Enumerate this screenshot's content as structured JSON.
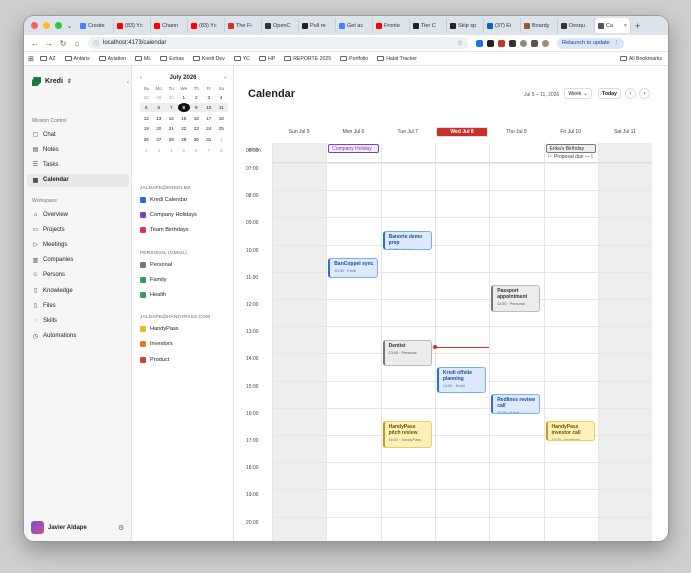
{
  "browser": {
    "tabs": [
      {
        "label": "Create",
        "color": "#4285f4"
      },
      {
        "label": "(83) Yc",
        "color": "#ff0000"
      },
      {
        "label": "Chann",
        "color": "#ff0000"
      },
      {
        "label": "(83) Yc",
        "color": "#ff0000"
      },
      {
        "label": "The Fi",
        "color": "#d93025"
      },
      {
        "label": "OpenC",
        "color": "#333333"
      },
      {
        "label": "Pull re",
        "color": "#222222"
      },
      {
        "label": "Get ac",
        "color": "#4285f4"
      },
      {
        "label": "Fronte",
        "color": "#ff0000"
      },
      {
        "label": "Tier C",
        "color": "#222222"
      },
      {
        "label": "Skip sp",
        "color": "#222222"
      },
      {
        "label": "(37) Ei",
        "color": "#0a66c2"
      },
      {
        "label": "Boardy",
        "color": "#8a5a3c"
      },
      {
        "label": "Desqu",
        "color": "#333333"
      },
      {
        "label": "Ca",
        "color": "#555555",
        "active": true
      }
    ],
    "url": "localhost:4173/calendar",
    "relaunch": "Relaunch to update",
    "bookmarks": [
      "AZ",
      "Antaris",
      "Aviation",
      "ML",
      "Extras",
      "Kredi Dev",
      "YC",
      "HP",
      "REPORTE 2025",
      "Portfolio",
      "Habit Tracker"
    ],
    "all_bookmarks": "All Bookmarks"
  },
  "sidebar": {
    "brand": "Kredi",
    "section1": "Mission Control",
    "items1": [
      {
        "label": "Chat",
        "icon": "chat-icon",
        "glyph": "▢"
      },
      {
        "label": "Notes",
        "icon": "notes-icon",
        "glyph": "▤"
      },
      {
        "label": "Tasks",
        "icon": "tasks-icon",
        "glyph": "☰"
      },
      {
        "label": "Calendar",
        "icon": "calendar-icon",
        "glyph": "▦",
        "selected": true
      }
    ],
    "section2": "Workspace",
    "items2": [
      {
        "label": "Overview",
        "icon": "home-icon",
        "glyph": "⌂"
      },
      {
        "label": "Projects",
        "icon": "folder-icon",
        "glyph": "▭"
      },
      {
        "label": "Meetings",
        "icon": "video-icon",
        "glyph": "▷"
      },
      {
        "label": "Companies",
        "icon": "building-icon",
        "glyph": "▥"
      },
      {
        "label": "Persons",
        "icon": "people-icon",
        "glyph": "☺"
      },
      {
        "label": "Knowledge",
        "icon": "book-icon",
        "glyph": "▯"
      },
      {
        "label": "Files",
        "icon": "file-icon",
        "glyph": "▯"
      },
      {
        "label": "Skills",
        "icon": "bulb-icon",
        "glyph": "◌"
      },
      {
        "label": "Automations",
        "icon": "clock-icon",
        "glyph": "◷"
      }
    ],
    "user": "Javier Aldape"
  },
  "mini_calendar": {
    "month": "July 2026",
    "weekdays": [
      "Su",
      "Mo",
      "Tu",
      "We",
      "Th",
      "Fr",
      "Sa"
    ],
    "weeks": [
      [
        "28",
        "29",
        "30",
        "1",
        "2",
        "3",
        "4"
      ],
      [
        "5",
        "6",
        "7",
        "8",
        "9",
        "10",
        "11"
      ],
      [
        "12",
        "13",
        "14",
        "15",
        "16",
        "17",
        "18"
      ],
      [
        "19",
        "20",
        "21",
        "22",
        "23",
        "24",
        "25"
      ],
      [
        "26",
        "27",
        "28",
        "29",
        "30",
        "31",
        "1"
      ],
      [
        "2",
        "3",
        "4",
        "5",
        "6",
        "7",
        "8"
      ]
    ],
    "today": "8"
  },
  "calendar_lists": [
    {
      "heading": "JALDAPE@KREDI.MX",
      "items": [
        {
          "label": "Kredi Calendar",
          "color": "#2b6fd6"
        },
        {
          "label": "Company Holidays",
          "color": "#7b3fc4"
        },
        {
          "label": "Team Birthdays",
          "color": "#d6336c"
        }
      ]
    },
    {
      "heading": "PERSONAL (GMAIL)",
      "items": [
        {
          "label": "Personal",
          "color": "#777777"
        },
        {
          "label": "Family",
          "color": "#2f9e57"
        },
        {
          "label": "Health",
          "color": "#2f9e57"
        }
      ]
    },
    {
      "heading": "JALDAPE@HANDYPASS.COM",
      "items": [
        {
          "label": "HandyPass",
          "color": "#e8b923"
        },
        {
          "label": "Investors",
          "color": "#e8772e"
        },
        {
          "label": "Product",
          "color": "#d63a3a"
        }
      ]
    }
  ],
  "main": {
    "title": "Calendar",
    "range": "Jul 5 – 11, 2026",
    "view": "Week",
    "today_btn": "Today",
    "days": [
      "Sun Jul 5",
      "Mon Jul 6",
      "Tue Jul 7",
      "Wed Jul 8",
      "Thu Jul 9",
      "Fri Jul 10",
      "Sat Jul 11"
    ],
    "today_index": 3,
    "allday_label": "All day",
    "hours": [
      "08:00",
      "07:00",
      "08:00",
      "09:00",
      "10:00",
      "11:00",
      "12:00",
      "13:00",
      "14:00",
      "15:00",
      "16:00",
      "17:00",
      "18:00",
      "19:00",
      "20:00"
    ],
    "allday_events": [
      {
        "title": "Company Holiday",
        "day": 1,
        "color": "#7b3fc4"
      },
      {
        "title": "Erika's Birthday",
        "day": 5,
        "color": "#777777"
      }
    ],
    "proposal": "Proposal due — I",
    "events": [
      {
        "title": "Banorte demo prep",
        "sub": "09:30 · Kredi",
        "day": 2,
        "start": 9.5,
        "end": 10.25,
        "style": "blue"
      },
      {
        "title": "BanCoppel sync",
        "sub": "10:00 · Kredi",
        "day": 1,
        "start": 10.5,
        "end": 11.25,
        "style": "blue"
      },
      {
        "title": "Passport appointment",
        "sub": "11:00 · Personal",
        "day": 4,
        "start": 11.5,
        "end": 12.5,
        "style": "gray"
      },
      {
        "title": "Dentist",
        "sub": "13:00 · Personal",
        "day": 2,
        "start": 13.5,
        "end": 14.5,
        "style": "gray"
      },
      {
        "title": "Kredi offsite planning",
        "sub": "14:00 · Kredi",
        "day": 3,
        "start": 14.5,
        "end": 15.5,
        "style": "blue"
      },
      {
        "title": "Redlines review call",
        "sub": "15:30 · Kredi",
        "day": 4,
        "start": 15.5,
        "end": 16.25,
        "style": "blue"
      },
      {
        "title": "HandyPass pitch review",
        "sub": "16:00 · HandyPass",
        "day": 2,
        "start": 16.5,
        "end": 17.5,
        "style": "yel"
      },
      {
        "title": "HandyPass investor call",
        "sub": "16:30 · Investors",
        "day": 5,
        "start": 16.5,
        "end": 17.25,
        "style": "yel"
      }
    ],
    "now": 13.75
  }
}
